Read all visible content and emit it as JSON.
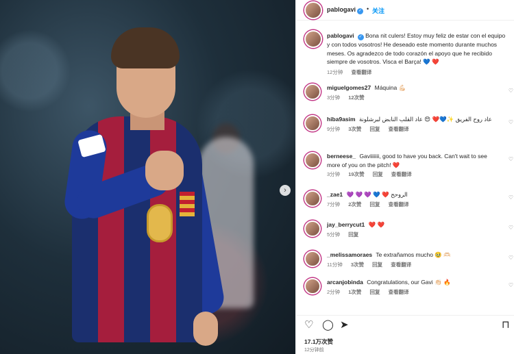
{
  "post": {
    "image_alt": "Gavi in FC Barcelona kit",
    "carousel_next": "›"
  },
  "header": {
    "username": "pablogavi",
    "verified_mark": "✓",
    "dot": "•",
    "follow_label": "关注"
  },
  "caption": {
    "username": "pablogavi",
    "text": "Bona nit culers! Estoy muy feliz de estar con el equipo y con todos vosotros! He deseado este momento durante muchos meses. Os agradezco de todo corazón el apoyo que he recibido siempre de vosotros. Visca el Barça! 💙 ❤️",
    "time": "12分钟",
    "translate": "查看翻译"
  },
  "comments": [
    {
      "username": "miguelgomes27",
      "text": "Máquina 💪🏻",
      "time": "3分钟",
      "likes": "12次赞",
      "reply": "",
      "translate": ""
    },
    {
      "username": "hiba9asim",
      "text": "عاد روح الفريق ✨💙❤️ 😍 عاد القلب النابض لبرشلونة",
      "time": "9分钟",
      "likes": "3次赞",
      "reply": "回复",
      "translate": "查看翻译"
    },
    {
      "username": "berneese_",
      "text": "Gaviiiiiii, good to have you back. Can't wait to see more of you on the pitch! ❤️",
      "time": "3分钟",
      "likes": "19次赞",
      "reply": "回复",
      "translate": "查看翻译"
    },
    {
      "username": "_zae1",
      "text": "💜 💜 💜 💙 ❤️ الروحح",
      "time": "7分钟",
      "likes": "2次赞",
      "reply": "回复",
      "translate": "查看翻译"
    },
    {
      "username": "jay_berrycut1",
      "text": "❤️ ❤️",
      "time": "5分钟",
      "likes": "",
      "reply": "回复",
      "translate": ""
    },
    {
      "username": "_melissamoraes",
      "text": "Te extrañamos mucho 🥹 🫶🏻",
      "time": "11分钟",
      "likes": "3次赞",
      "reply": "回复",
      "translate": "查看翻译"
    },
    {
      "username": "arcanjobinda",
      "text": "Congratulations, our Gavi 👏🏻 🔥",
      "time": "2分钟",
      "likes": "1次赞",
      "reply": "回复",
      "translate": "查看翻译"
    }
  ],
  "actions": {
    "like_icon": "♡",
    "comment_icon": "◯",
    "share_icon": "➤",
    "save_icon": "⊓"
  },
  "stats": {
    "likes": "17.1万次赞",
    "time": "12分钟前"
  },
  "colors": {
    "accent": "#0095f6",
    "verified": "#3897f0",
    "ring": "#c13584"
  }
}
